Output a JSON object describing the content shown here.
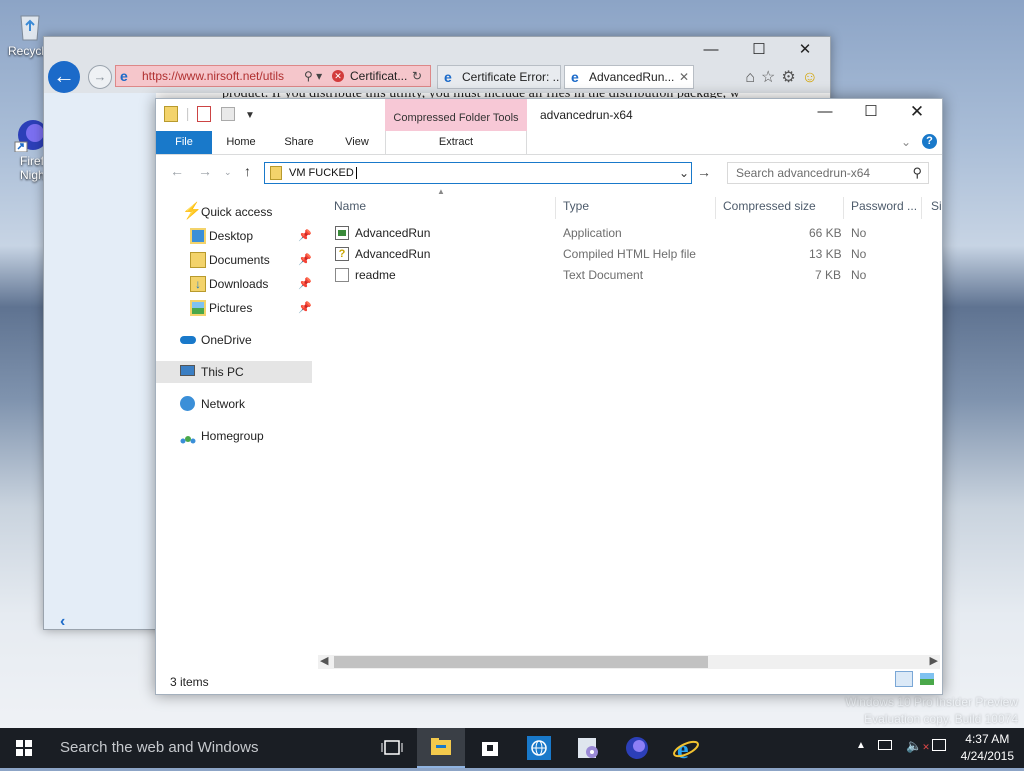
{
  "desktop": {
    "icons": [
      {
        "label": "Recycl"
      },
      {
        "label": "Firef\nNigh"
      }
    ],
    "watermark": {
      "line1": "Windows 10 Pro Insider Preview",
      "line2": "Evaluation copy. Build 10074"
    }
  },
  "browser": {
    "address": "https://www.nirsoft.net/utils",
    "tabs": [
      {
        "label": "Certificat..."
      },
      {
        "label": "Certificate Error: ..."
      },
      {
        "label": "AdvancedRun..."
      }
    ],
    "page_text": "product. If you distribute this utility, you must include all files in the distribution package, w"
  },
  "explorer": {
    "title": "advancedrun-x64",
    "context_group": "Compressed Folder Tools",
    "ribbon_tabs": [
      "File",
      "Home",
      "Share",
      "View",
      "Extract"
    ],
    "address_value": "VM FUCKED",
    "search_placeholder": "Search advancedrun-x64",
    "nav": {
      "quick_access": "Quick access",
      "items": [
        "Desktop",
        "Documents",
        "Downloads",
        "Pictures"
      ],
      "onedrive": "OneDrive",
      "this_pc": "This PC",
      "network": "Network",
      "homegroup": "Homegroup"
    },
    "columns": [
      "Name",
      "Type",
      "Compressed size",
      "Password ...",
      "Si"
    ],
    "files": [
      {
        "name": "AdvancedRun",
        "type": "Application",
        "size": "66 KB",
        "password": "No",
        "icon": "application-icon"
      },
      {
        "name": "AdvancedRun",
        "type": "Compiled HTML Help file",
        "size": "13 KB",
        "password": "No",
        "icon": "help-file-icon"
      },
      {
        "name": "readme",
        "type": "Text Document",
        "size": "7 KB",
        "password": "No",
        "icon": "text-file-icon"
      }
    ],
    "status": "3 items"
  },
  "taskbar": {
    "search": "Search the web and Windows",
    "time": "4:37 AM",
    "date": "4/24/2015"
  }
}
